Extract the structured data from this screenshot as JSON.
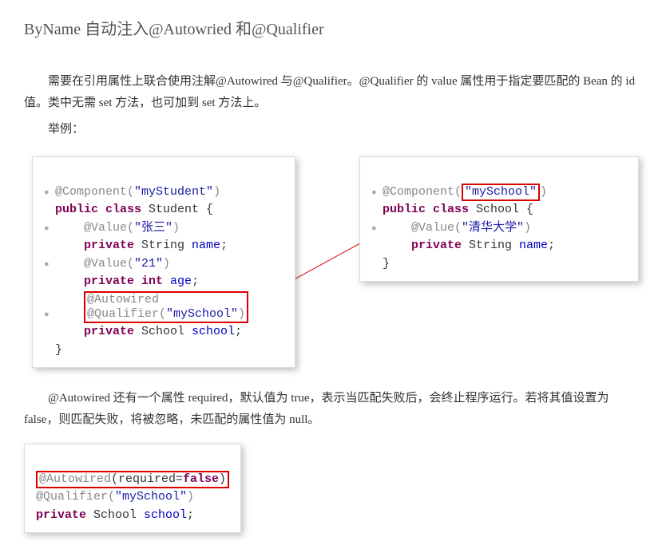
{
  "title": "ByName 自动注入@Autowried 和@Qualifier",
  "para1": "需要在引用属性上联合使用注解@Autowired 与@Qualifier。@Qualifier 的 value 属性用于指定要匹配的 Bean 的 id 值。类中无需 set 方法，也可加到 set 方法上。",
  "para2": "举例：",
  "left_code": {
    "l1a": "@Component(",
    "l1b": "\"myStudent\"",
    "l1c": ")",
    "l2a": "public class ",
    "l2b": "Student {",
    "l3a": "@Value(",
    "l3b": "\"张三\"",
    "l3c": ")",
    "l4a": "private ",
    "l4b": "String ",
    "l4c": "name",
    "l4d": ";",
    "l5a": "@Value(",
    "l5b": "\"21\"",
    "l5c": ")",
    "l6a": "private int ",
    "l6b": "age",
    "l6c": ";",
    "l7": "@Autowired",
    "l8a": "@Qualifier(",
    "l8b": "\"mySchool\"",
    "l8c": ")",
    "l9a": "private ",
    "l9b": "School ",
    "l9c": "school",
    "l9d": ";",
    "l10": "}"
  },
  "right_code": {
    "l1a": "@Component(",
    "l1b": "\"mySchool\"",
    "l1c": ")",
    "l2a": "public class ",
    "l2b": "School {",
    "l3a": "@Value(",
    "l3b": "\"清华大学\"",
    "l3c": ")",
    "l4a": "private ",
    "l4b": "String ",
    "l4c": "name",
    "l4d": ";",
    "l5": "}"
  },
  "para3": "@Autowired 还有一个属性 required，默认值为 true，表示当匹配失败后，会终止程序运行。若将其值设置为 false，则匹配失败，将被忽略，未匹配的属性值为 null。",
  "bottom_code": {
    "l1a": "@Autowired",
    "l1b": "(required=",
    "l1c": "false",
    "l1d": ")",
    "l2a": "@Qualifier(",
    "l2b": "\"mySchool\"",
    "l2c": ")",
    "l3a": "private ",
    "l3b": "School ",
    "l3c": "school",
    "l3d": ";"
  }
}
